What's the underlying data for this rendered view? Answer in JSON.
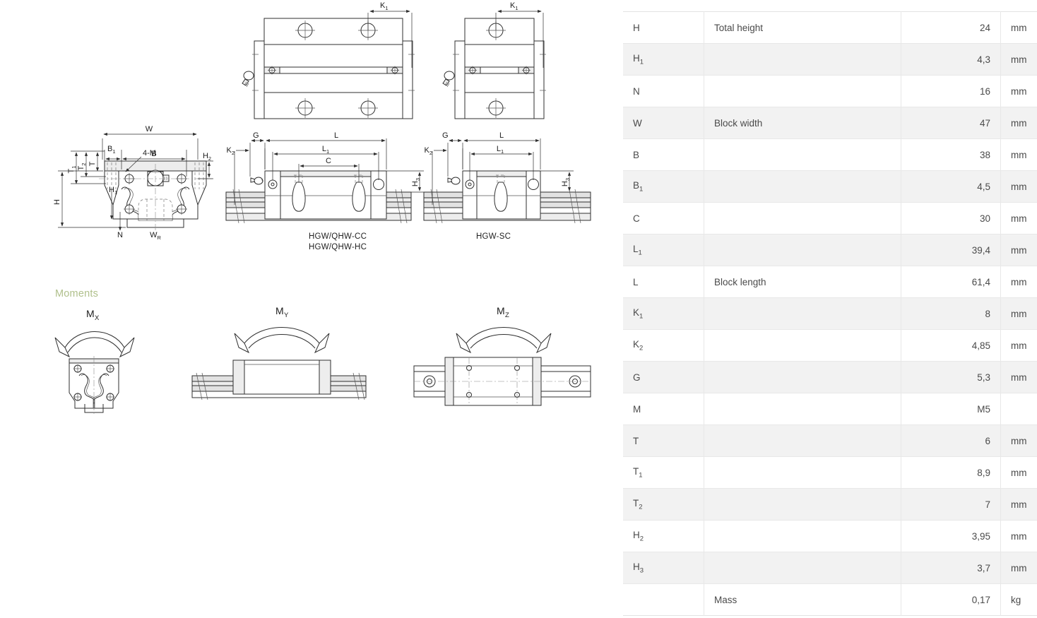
{
  "drawings": {
    "captions": [
      {
        "id": "cc-hc",
        "lines": [
          "HGW/QHW-CC",
          "HGW/QHW-HC"
        ]
      },
      {
        "id": "sc",
        "lines": [
          "HGW-SC"
        ]
      }
    ],
    "dimension_labels": {
      "top_views": [
        "K1",
        "K1"
      ],
      "front_view": [
        "W",
        "B",
        "B1",
        "H2",
        "4-M",
        "T",
        "T1",
        "T2",
        "H",
        "H1",
        "N",
        "WR"
      ],
      "side_views": [
        "G",
        "K2",
        "L",
        "L1",
        "C",
        "H3",
        "G",
        "K2",
        "L",
        "L1",
        "H3"
      ]
    }
  },
  "moments": {
    "title": "Moments",
    "items": [
      {
        "label": "M",
        "sub": "X"
      },
      {
        "label": "M",
        "sub": "Y"
      },
      {
        "label": "M",
        "sub": "Z"
      }
    ]
  },
  "spec_table": {
    "rows": [
      {
        "symbol": "H",
        "sub": "",
        "description": "Total height",
        "value": "24",
        "unit": "mm",
        "shaded": false
      },
      {
        "symbol": "H",
        "sub": "1",
        "description": "",
        "value": "4,3",
        "unit": "mm",
        "shaded": true
      },
      {
        "symbol": "N",
        "sub": "",
        "description": "",
        "value": "16",
        "unit": "mm",
        "shaded": false
      },
      {
        "symbol": "W",
        "sub": "",
        "description": "Block width",
        "value": "47",
        "unit": "mm",
        "shaded": true
      },
      {
        "symbol": "B",
        "sub": "",
        "description": "",
        "value": "38",
        "unit": "mm",
        "shaded": false
      },
      {
        "symbol": "B",
        "sub": "1",
        "description": "",
        "value": "4,5",
        "unit": "mm",
        "shaded": true
      },
      {
        "symbol": "C",
        "sub": "",
        "description": "",
        "value": "30",
        "unit": "mm",
        "shaded": false
      },
      {
        "symbol": "L",
        "sub": "1",
        "description": "",
        "value": "39,4",
        "unit": "mm",
        "shaded": true
      },
      {
        "symbol": "L",
        "sub": "",
        "description": "Block length",
        "value": "61,4",
        "unit": "mm",
        "shaded": false
      },
      {
        "symbol": "K",
        "sub": "1",
        "description": "",
        "value": "8",
        "unit": "mm",
        "shaded": true
      },
      {
        "symbol": "K",
        "sub": "2",
        "description": "",
        "value": "4,85",
        "unit": "mm",
        "shaded": false
      },
      {
        "symbol": "G",
        "sub": "",
        "description": "",
        "value": "5,3",
        "unit": "mm",
        "shaded": true
      },
      {
        "symbol": "M",
        "sub": "",
        "description": "",
        "value": "M5",
        "unit": "",
        "shaded": false
      },
      {
        "symbol": "T",
        "sub": "",
        "description": "",
        "value": "6",
        "unit": "mm",
        "shaded": true
      },
      {
        "symbol": "T",
        "sub": "1",
        "description": "",
        "value": "8,9",
        "unit": "mm",
        "shaded": false
      },
      {
        "symbol": "T",
        "sub": "2",
        "description": "",
        "value": "7",
        "unit": "mm",
        "shaded": true
      },
      {
        "symbol": "H",
        "sub": "2",
        "description": "",
        "value": "3,95",
        "unit": "mm",
        "shaded": false
      },
      {
        "symbol": "H",
        "sub": "3",
        "description": "",
        "value": "3,7",
        "unit": "mm",
        "shaded": true
      },
      {
        "symbol": "",
        "sub": "",
        "description": "Mass",
        "value": "0,17",
        "unit": "kg",
        "shaded": false
      }
    ]
  },
  "colors": {
    "accent_green": "#b0c08c",
    "row_shade": "#f2f2f2",
    "border": "#e8e8e8",
    "text": "#4a4a4a",
    "line": "#333333"
  }
}
